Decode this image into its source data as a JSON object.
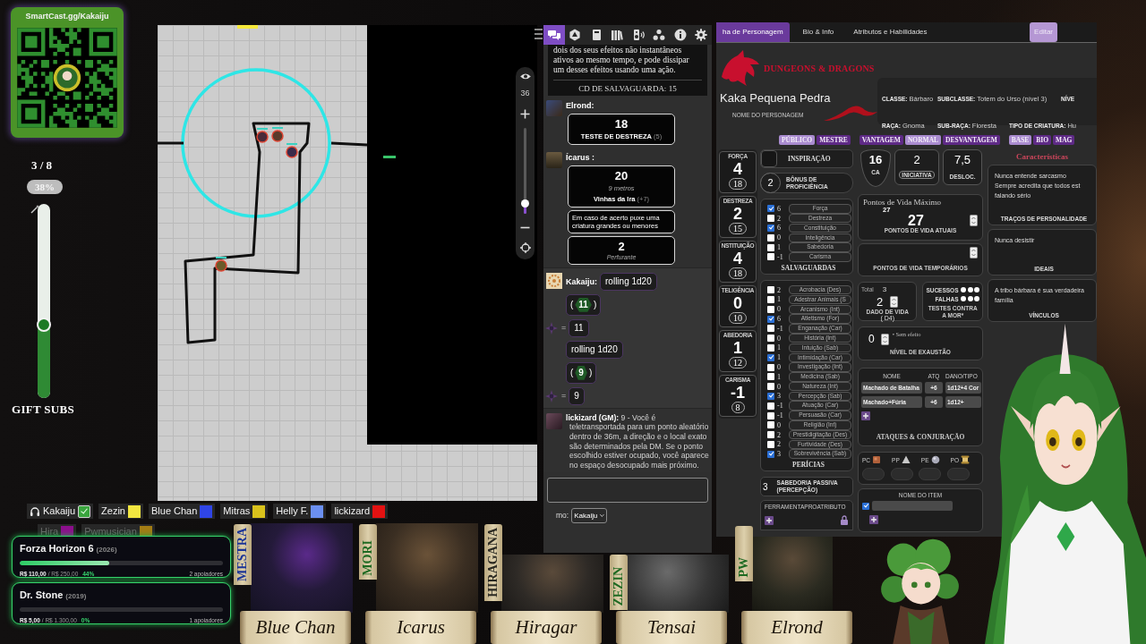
{
  "qr_card": {
    "title": "SmartCast.gg/Kakaiju"
  },
  "gift_subs": {
    "count": "3 / 8",
    "percent": "38%",
    "level": 0.38,
    "label": "GIFT SUBS"
  },
  "map": {
    "zoom": "36",
    "zoom_slider": {
      "level": 0.12
    }
  },
  "chat": {
    "tabs": [
      {
        "kind": "chat",
        "selected": true
      },
      {
        "kind": "dice",
        "selected": false
      },
      {
        "kind": "journal",
        "selected": false
      },
      {
        "kind": "library",
        "selected": false
      },
      {
        "kind": "audio",
        "selected": false
      },
      {
        "kind": "nodes",
        "selected": false
      },
      {
        "kind": "info",
        "selected": false
      },
      {
        "kind": "settings",
        "selected": false
      }
    ],
    "spell": {
      "text": "dois dos seus efeitos não instantâneos ativos ao mesmo tempo, e pode dissipar um desses efeitos usando uma ação.",
      "save": "CD DE SALVAGUARDA: 15"
    },
    "messages": [
      {
        "kind": "check",
        "author": "Elrond:",
        "result": "18",
        "label": "TESTE DE DESTREZA",
        "modifier": "(5)"
      },
      {
        "kind": "attack",
        "author": "Ícarus :",
        "result": "20",
        "range": "9 metros",
        "name": "Vinhas da Ira",
        "modifier": "(+7)",
        "description": "Em caso de acerto puxe uma criatura grandes ou menores",
        "damage": "2",
        "damage_type": "Perfurante"
      },
      {
        "kind": "rolls",
        "author": "Kakaiju:",
        "rolls": [
          {
            "command": "rolling 1d20",
            "open": "(",
            "die": "11",
            "close": ")",
            "equals": "=",
            "total": "11"
          },
          {
            "command": "rolling 1d20",
            "open": "(",
            "die": "9",
            "close": ")",
            "equals": "=",
            "total": "9"
          }
        ]
      },
      {
        "kind": "text",
        "author": "lickizard (GM):",
        "text": "9 - Você é teletransportada para um ponto aleatório dentro de 36m, a direção e o local exato são determinados pela DM. Se o ponto escolhido estiver ocupado, você aparece no espaço desocupado mais próximo."
      }
    ],
    "speaker": {
      "label": "mo:",
      "value": "Kakaiju"
    }
  },
  "sheet": {
    "tabs": [
      {
        "label": "ha de Personagem",
        "selected": true
      },
      {
        "label": "Bio & Info",
        "selected": false
      },
      {
        "label": "Atributos e Habilidades",
        "selected": false
      }
    ],
    "edit_button": "Editar",
    "logo": "DUNGEONS & DRAGONS",
    "character_name": "Kaka Pequena Pedra",
    "character_name_label": "NOME DO PERSONAGEM",
    "info": [
      [
        {
          "label": "CLASSE:",
          "value": "Bárbaro"
        },
        {
          "label": "SUBCLASSE:",
          "value": "Totem do Urso (nível 3)"
        },
        {
          "label": "NÍVE"
        }
      ],
      [
        {
          "label": "RAÇA:",
          "value": "Gnoma"
        },
        {
          "label": "SUB-RAÇA:",
          "value": "Floresta"
        },
        {
          "label": "TIPO DE CRIATURA:",
          "value": "Hu"
        }
      ]
    ],
    "toggle_groups": [
      [
        {
          "label": "PÚBLICO",
          "selected": true
        },
        {
          "label": "MESTRE",
          "selected": false
        }
      ],
      [
        {
          "label": "VANTAGEM",
          "selected": false
        },
        {
          "label": "NORMAL",
          "selected": true
        },
        {
          "label": "DESVANTAGEM",
          "selected": false
        }
      ],
      [
        {
          "label": "BASE",
          "selected": true
        },
        {
          "label": "BIO",
          "selected": false
        },
        {
          "label": "MAG",
          "selected": false
        }
      ]
    ],
    "abilities": [
      {
        "name": "FORÇA",
        "modifier": "4",
        "score": "18"
      },
      {
        "name": "DESTREZA",
        "modifier": "2",
        "score": "15"
      },
      {
        "name": "NSTITUIÇÃO",
        "modifier": "4",
        "score": "18"
      },
      {
        "name": "TELIGÊNCIA",
        "modifier": "0",
        "score": "10"
      },
      {
        "name": "ABEDORIA",
        "modifier": "1",
        "score": "12"
      },
      {
        "name": "CARISMA",
        "modifier": "-1",
        "score": "8"
      }
    ],
    "inspiration": {
      "label": "INSPIRAÇÃO",
      "checked": false
    },
    "proficiency": {
      "value": "2",
      "label": "BÔNUS DE PROFICIÊNCIA"
    },
    "saves": {
      "title": "SALVAGUARDAS",
      "items": [
        {
          "value": "6",
          "name": "Força",
          "checked": true
        },
        {
          "value": "2",
          "name": "Destreza",
          "checked": false
        },
        {
          "value": "6",
          "name": "Constituição",
          "checked": true
        },
        {
          "value": "0",
          "name": "Inteligência",
          "checked": false
        },
        {
          "value": "1",
          "name": "Sabedoria",
          "checked": false
        },
        {
          "value": "-1",
          "name": "Carisma",
          "checked": false
        }
      ]
    },
    "skills": {
      "title": "PERÍCIAS",
      "items": [
        {
          "value": "2",
          "name": "Acrobacia (Des)",
          "checked": false
        },
        {
          "value": "1",
          "name": "Adestrar Animais (S",
          "checked": false
        },
        {
          "value": "0",
          "name": "Arcanismo (Int)",
          "checked": false
        },
        {
          "value": "6",
          "name": "Atletismo (For)",
          "checked": true
        },
        {
          "value": "-1",
          "name": "Enganação (Car)",
          "checked": false
        },
        {
          "value": "0",
          "name": "História (Int)",
          "checked": false
        },
        {
          "value": "1",
          "name": "Intuição (Sab)",
          "checked": false
        },
        {
          "value": "1",
          "name": "Intimidação (Car)",
          "checked": true
        },
        {
          "value": "0",
          "name": "Investigação (Int)",
          "checked": false
        },
        {
          "value": "1",
          "name": "Medicina (Sab)",
          "checked": false
        },
        {
          "value": "0",
          "name": "Natureza (Int)",
          "checked": false
        },
        {
          "value": "3",
          "name": "Percepção (Sab)",
          "checked": true
        },
        {
          "value": "-1",
          "name": "Atuação (Car)",
          "checked": false
        },
        {
          "value": "-1",
          "name": "Persuasão (Car)",
          "checked": false
        },
        {
          "value": "0",
          "name": "Religião (Int)",
          "checked": false
        },
        {
          "value": "2",
          "name": "Prestidigitação (Des)",
          "checked": false
        },
        {
          "value": "2",
          "name": "Furtividade (Des)",
          "checked": false
        },
        {
          "value": "3",
          "name": "Sobrevivência (Sab)",
          "checked": true
        }
      ]
    },
    "passive": {
      "value": "3",
      "label": "SABEDORIA PASSIVA (PERCEPÇÃO)"
    },
    "tools": {
      "columns": [
        "FERRAMENTA",
        "PRO",
        "ATRIBUTO"
      ]
    },
    "stats": [
      {
        "kind": "shield",
        "value": "16",
        "label": "CA"
      },
      {
        "kind": "pill",
        "value": "2",
        "label": "INICIATIVA"
      },
      {
        "kind": "plain",
        "value": "7,5",
        "label": "DESLOC."
      }
    ],
    "hit_points": {
      "max_label": "Pontos de Vida Máximo",
      "max": "27",
      "current": "27",
      "current_label": "PONTOS DE VIDA ATUAIS",
      "temp_label": "PONTOS DE VIDA TEMPORÁRIOS"
    },
    "hit_dice": {
      "total_label": "Total",
      "total": "3",
      "value": "2",
      "label": "DADO DE VIDA",
      "die": "( D4)"
    },
    "death_saves": {
      "rows": [
        {
          "label": "SUCESSOS",
          "marks": [
            {
              "checked": false
            },
            {
              "checked": false
            },
            {
              "checked": false
            }
          ]
        },
        {
          "label": "FALHAS",
          "marks": [
            {
              "checked": false
            },
            {
              "checked": false
            },
            {
              "checked": false
            }
          ]
        }
      ],
      "label": "TESTES CONTRA A MOR*"
    },
    "exhaustion": {
      "value": "0",
      "note": "• Sem efeito",
      "label": "NÍVEL DE EXAUSTÃO"
    },
    "attacks": {
      "columns": [
        "NOME",
        "ATQ",
        "DANO/TIPO"
      ],
      "rows": [
        {
          "name": "Machado de Batalha",
          "bonus": "+6",
          "damage": "1d12+4 Cor"
        },
        {
          "name": "Machado+Fúria",
          "bonus": "+6",
          "damage": "1d12+"
        }
      ],
      "title": "ATAQUES & CONJURAÇÃO"
    },
    "coins": [
      {
        "kind": "copper",
        "label": "PC"
      },
      {
        "kind": "silver",
        "label": "PP"
      },
      {
        "kind": "electrum",
        "label": "PE"
      },
      {
        "kind": "gold",
        "label": "PO"
      }
    ],
    "items": {
      "title": "NOME DO ITEM",
      "rows": [
        {
          "checked": true
        }
      ]
    },
    "characteristics": {
      "title": "Características",
      "boxes": [
        {
          "lines": [
            "Nunca entende sarcasmo",
            "Sempre acredita que todos est",
            "falando sério"
          ],
          "label": "TRAÇOS DE PERSONALIDADE"
        },
        {
          "lines": [
            "Nunca desistir"
          ],
          "label": "IDEAIS"
        },
        {
          "lines": [
            "A tribo bárbara é sua verdadeira",
            "família"
          ],
          "label": "VÍNCULOS"
        }
      ]
    }
  },
  "players": [
    {
      "kind": "self",
      "name": "Kakaiju",
      "color": "#3aa53e",
      "online": true
    },
    {
      "kind": "player",
      "name": "Zezin",
      "color": "#f2e640",
      "online": true
    },
    {
      "kind": "player",
      "name": "Blue Chan",
      "color": "#2f45e6",
      "online": true
    },
    {
      "kind": "player",
      "name": "Mitras",
      "color": "#d9c21c",
      "online": true
    },
    {
      "kind": "player",
      "name": "Helly F.",
      "color": "#6b8ff0",
      "online": true
    },
    {
      "kind": "player",
      "name": "lickizard",
      "color": "#e31212",
      "online": true
    },
    {
      "kind": "player",
      "name": "Hira",
      "color": "#8c0f8c",
      "online": false
    },
    {
      "kind": "player",
      "name": "Pwmusician",
      "color": "#a27c14",
      "online": false
    }
  ],
  "goals": [
    {
      "title": "Forza Horizon 6",
      "year": "(2026)",
      "level": 0.44,
      "raised": "R$ 110,00",
      "target": "/ R$ 250,00",
      "percent": "44%",
      "supporters": "2 apoiadores"
    },
    {
      "title": "Dr. Stone",
      "year": "(2019)",
      "level": 0,
      "raised": "R$ 5,00",
      "target": "/ R$ 1.300,00",
      "percent": "0%",
      "supporters": "1 apoiadores"
    }
  ],
  "party": [
    {
      "tag": "MESTRA",
      "color": "#1c3596",
      "name": "Blue Chan"
    },
    {
      "tag": "MORI",
      "color": "#1f6a22",
      "name": "Icarus"
    },
    {
      "tag": "HIRAGANA",
      "color": "#2b2a22",
      "name": "Hiragar"
    },
    {
      "tag": "ZEZIN",
      "color": "#1f6a22",
      "name": "Tensai"
    },
    {
      "tag": "PW",
      "color": "#1f6a22",
      "name": "Elrond"
    }
  ]
}
